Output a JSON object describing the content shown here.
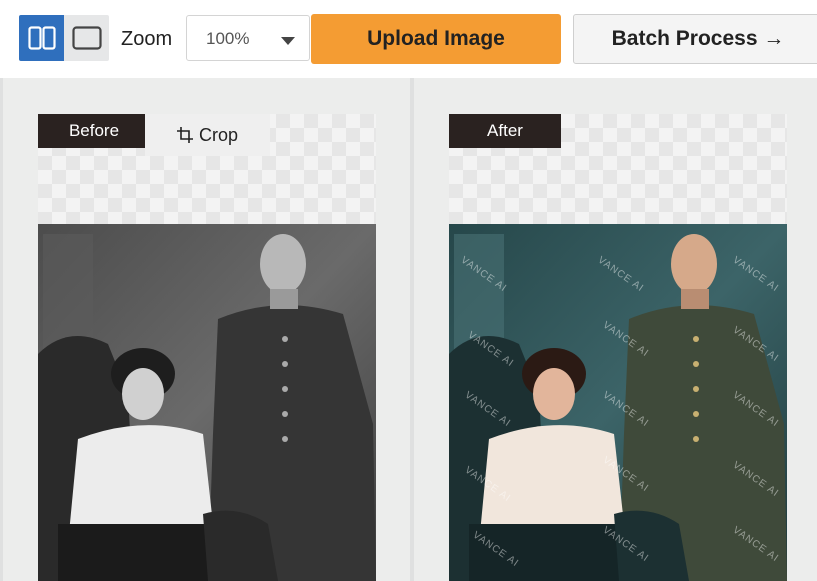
{
  "toolbar": {
    "view_modes": [
      {
        "name": "split-view",
        "active": true
      },
      {
        "name": "single-view",
        "active": false
      }
    ],
    "zoom_label": "Zoom",
    "zoom_value": "100%",
    "upload_label": "Upload Image",
    "batch_label": "Batch Process →"
  },
  "before_panel": {
    "tag": "Before",
    "crop_label": "Crop"
  },
  "after_panel": {
    "tag": "After",
    "watermark_text": "VANCE AI"
  },
  "colors": {
    "accent_blue": "#2f6fbd",
    "upload_orange": "#f49c33",
    "tag_dark": "#2a2220"
  }
}
